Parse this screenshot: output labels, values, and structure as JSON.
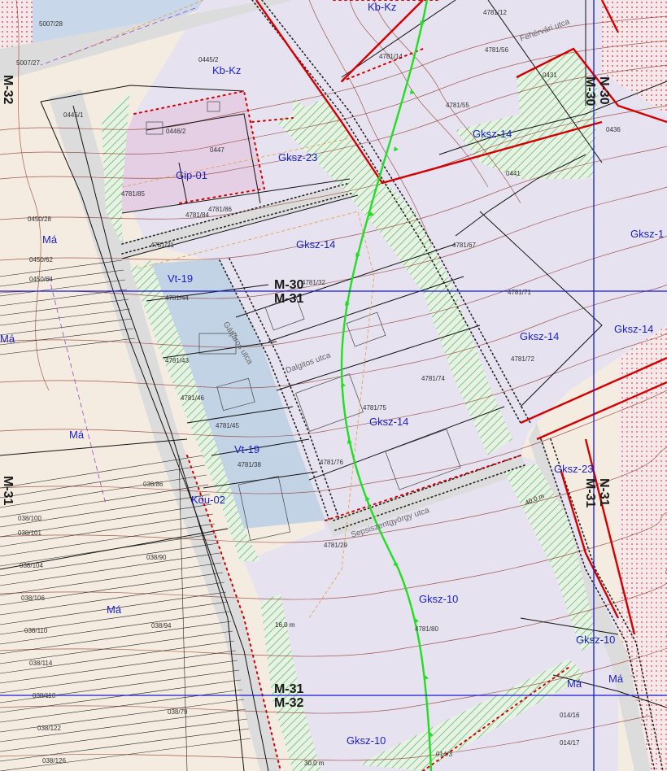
{
  "colors": {
    "background_ma": "#f4ece0",
    "gksz_fill": "#e6e2f0",
    "vt_fill": "#c3d3e6",
    "gip_fill": "#e5cfe4",
    "green_hatch": "#4fb55a",
    "road_fill": "#dcdcdc",
    "contour": "#8a2a1c",
    "zone_boundary": "#d40000",
    "sheet_grid": "#1a1ad0",
    "parcel_line": "#111111",
    "power_line": "#22dd22",
    "zone_text": "#1a1fc8"
  },
  "zones": {
    "kbkz_top": "Kb-Kz",
    "kbkz": "Kb-Kz",
    "gip01": "Gip-01",
    "gksz23_a": "Gksz-23",
    "gksz14_ne": "Gksz-14",
    "gksz14_c": "Gksz-14",
    "gksz14_e_edge": "Gksz-1",
    "gksz14_e": "Gksz-14",
    "gksz14_e2": "Gksz-14",
    "gksz14_s": "Gksz-14",
    "vt19_a": "Vt-19",
    "vt19_b": "Vt-19",
    "kou02": "Köu-02",
    "gksz23_b": "Gksz-23",
    "gksz10_a": "Gksz-10",
    "gksz10_b": "Gksz-10",
    "gksz10_c": "Gksz-10",
    "ma_1": "Má",
    "ma_2": "Má",
    "ma_3": "Má",
    "ma_4": "Má",
    "ma_5": "Má",
    "ma_6": "Má"
  },
  "sheets": {
    "m30_m31_a": "M-30",
    "m30_m31_b": "M-31",
    "m31_m32_a": "M-31",
    "m31_m32_b": "M-32",
    "n30_m30_a": "N-30",
    "n30_m30_b": "M-30",
    "n31_m31_a": "N-31",
    "n31_m31_b": "M-31",
    "m32_edge": "M-32",
    "m31_edge": "M-31"
  },
  "parcels": {
    "p5007_28": "5007/28",
    "p5007_27": "5007/27",
    "p0445_2": "0445/2",
    "p0445_1": "0445/1",
    "p0446_2": "0446/2",
    "p0447": "0447",
    "p4781_85": "4781/85",
    "p4781_84": "4781/84",
    "p4781_86": "4781/86",
    "p4781_21": "4781/21",
    "p4781_44": "4781/44",
    "p4781_43": "4781/43",
    "p4781_46": "4781/46",
    "p4781_45": "4781/45",
    "p4781_38": "4781/38",
    "p4781_29": "4781/29",
    "p4781_76": "4781/76",
    "p4781_75": "4781/75",
    "p4781_74": "4781/74",
    "p4781_72": "4781/72",
    "p4781_71": "4781/71",
    "p4781_67": "4781/67",
    "p4781_55": "4781/55",
    "p4781_56": "4781/56",
    "p4781_14": "4781/14",
    "p4781_12": "4781/12",
    "p4781_80": "4781/80",
    "p4781_32": "4781/32",
    "p0431": "0431",
    "p0441": "0441",
    "p0436": "0436",
    "p0450_28": "0450/28",
    "p0450_62": "0450/62",
    "p0450_64": "0450/64",
    "p014_16": "014/16",
    "p014_17": "014/17",
    "p014_3": "014/3",
    "p038_79": "038/79",
    "p038_100": "038/100",
    "p038_101": "038/101",
    "p038_104": "038/104",
    "p038_106": "038/106",
    "p038_110": "038/110",
    "p038_114": "038/114",
    "p038_118": "038/118",
    "p038_122": "038/122",
    "p038_126": "038/126",
    "p038_86": "038/86",
    "p038_90": "038/90",
    "p038_94": "038/94"
  },
  "streets": {
    "strt_sepsi": "Sepsiszentgyörgy utca",
    "strt_gatjaros": "Gátjáros utca",
    "strt_mid1": "Dalgitos utca",
    "strt_n": "Fehérvári utca"
  },
  "distances": {
    "d1": "40,0 m",
    "d2": "16,0 m",
    "d3": "30,0 m"
  }
}
